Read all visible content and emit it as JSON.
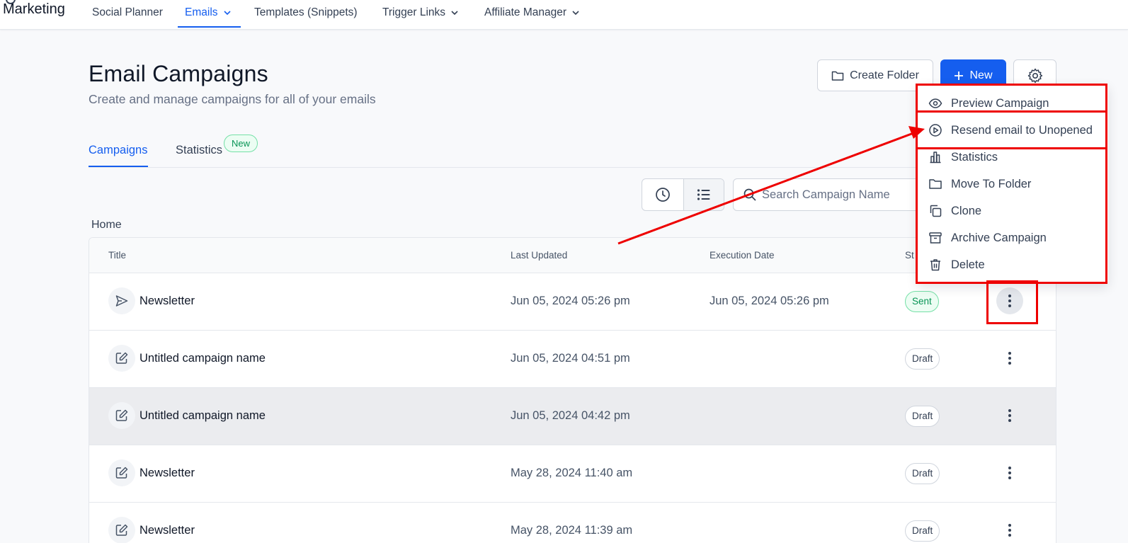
{
  "nav": {
    "brand": "Marketing",
    "items": [
      {
        "label": "Social Planner",
        "dropdown": false,
        "active": false
      },
      {
        "label": "Emails",
        "dropdown": true,
        "active": true
      },
      {
        "label": "Templates (Snippets)",
        "dropdown": false,
        "active": false
      },
      {
        "label": "Trigger Links",
        "dropdown": true,
        "active": false
      },
      {
        "label": "Affiliate Manager",
        "dropdown": true,
        "active": false
      }
    ]
  },
  "header": {
    "title": "Email Campaigns",
    "subtitle": "Create and manage campaigns for all of your emails",
    "create_folder_label": "Create Folder",
    "new_label": "New"
  },
  "tabs": {
    "campaigns_label": "Campaigns",
    "statistics_label": "Statistics",
    "statistics_badge": "New"
  },
  "search": {
    "placeholder": "Search Campaign Name"
  },
  "breadcrumb": "Home",
  "table": {
    "columns": {
      "title": "Title",
      "last_updated": "Last Updated",
      "execution_date": "Execution Date",
      "status": "St"
    },
    "rows": [
      {
        "title": "Newsletter",
        "icon": "send-icon",
        "last_updated": "Jun 05, 2024 05:26 pm",
        "execution_date": "Jun 05, 2024 05:26 pm",
        "status": "Sent"
      },
      {
        "title": "Untitled campaign name",
        "icon": "edit-icon",
        "last_updated": "Jun 05, 2024 04:51 pm",
        "execution_date": "",
        "status": "Draft"
      },
      {
        "title": "Untitled campaign name",
        "icon": "edit-icon",
        "last_updated": "Jun 05, 2024 04:42 pm",
        "execution_date": "",
        "status": "Draft"
      },
      {
        "title": "Newsletter",
        "icon": "edit-icon",
        "last_updated": "May 28, 2024 11:40 am",
        "execution_date": "",
        "status": "Draft"
      },
      {
        "title": "Newsletter",
        "icon": "edit-icon",
        "last_updated": "May 28, 2024 11:39 am",
        "execution_date": "",
        "status": "Draft"
      }
    ]
  },
  "menu": {
    "items": [
      {
        "label": "Preview Campaign",
        "icon": "eye-icon"
      },
      {
        "label": "Resend email to Unopened",
        "icon": "play-circle-icon"
      },
      {
        "label": "Statistics",
        "icon": "bar-chart-icon"
      },
      {
        "label": "Move To Folder",
        "icon": "folder-icon"
      },
      {
        "label": "Clone",
        "icon": "copy-icon"
      },
      {
        "label": "Archive Campaign",
        "icon": "archive-icon"
      },
      {
        "label": "Delete",
        "icon": "trash-icon"
      }
    ]
  },
  "colors": {
    "primary": "#155eef",
    "annotation_red": "#ee0000",
    "sent_green": "#079455"
  }
}
